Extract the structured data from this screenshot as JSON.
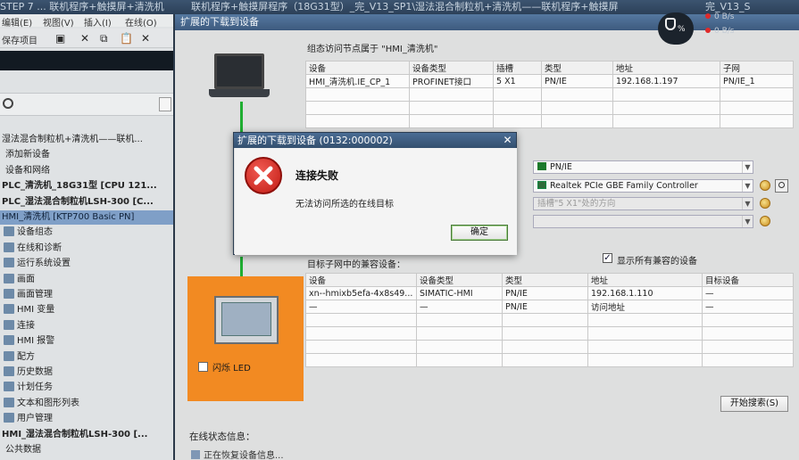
{
  "window": {
    "title_left": "STEP 7 ... 联机程序+触摸屏+清洗机",
    "title_main": "联机程序+触摸屏程序（18G31型）_完_V13_SP1\\湿法混合制粒机+清洗机——联机程序+触摸屏",
    "title_right": "完_V13_S"
  },
  "left_pane": {
    "menu": [
      "编辑(E)",
      "视图(V)",
      "插入(I)",
      "在线(O)"
    ],
    "toolbar_label": "保存项目",
    "toolbar_icons": [
      "save-icon",
      "cut-icon",
      "copy-icon",
      "paste-icon",
      "delete-icon"
    ],
    "toolbar_glyphs": [
      "▣",
      "✕",
      "⧉",
      "📋",
      "✕"
    ],
    "tree": [
      {
        "label": "湿法混合制粒机+清洗机——联机...",
        "style": "plain"
      },
      {
        "label": "添加新设备",
        "style": "plain"
      },
      {
        "label": "设备和网络",
        "style": "plain"
      },
      {
        "label": "PLC_清洗机_18G31型 [CPU 121...",
        "style": "bold"
      },
      {
        "label": "PLC_湿法混合制粒机LSH-300 [C...",
        "style": "bold"
      },
      {
        "label": "HMI_清洗机 [KTP700 Basic PN]",
        "style": "selected"
      },
      {
        "label": "设备组态",
        "style": "plain"
      },
      {
        "label": "在线和诊断",
        "style": "plain"
      },
      {
        "label": "运行系统设置",
        "style": "plain"
      },
      {
        "label": "画面",
        "style": "plain"
      },
      {
        "label": "画面管理",
        "style": "plain"
      },
      {
        "label": "HMI 变量",
        "style": "plain"
      },
      {
        "label": "连接",
        "style": "plain"
      },
      {
        "label": "HMI 报警",
        "style": "plain"
      },
      {
        "label": "配方",
        "style": "plain"
      },
      {
        "label": "历史数据",
        "style": "plain"
      },
      {
        "label": "计划任务",
        "style": "plain"
      },
      {
        "label": "文本和图形列表",
        "style": "plain"
      },
      {
        "label": "用户管理",
        "style": "plain"
      },
      {
        "label": "HMI_湿法混合制粒机LSH-300 [...",
        "style": "bold"
      },
      {
        "label": "公共数据",
        "style": "plain"
      }
    ]
  },
  "main": {
    "panel_title": "扩展的下载到设备",
    "config_header": "组态访问节点属于 \"HMI_清洗机\"",
    "config_table": {
      "columns": [
        "设备",
        "设备类型",
        "插槽",
        "类型",
        "地址",
        "子网"
      ],
      "rows": [
        [
          "HMI_清洗机.IE_CP_1",
          "PROFINET接口",
          "5 X1",
          "PN/IE",
          "192.168.1.197",
          "PN/IE_1"
        ]
      ]
    },
    "pgpc": {
      "interface_type": "PN/IE",
      "interface": "Realtek PCIe GBE Family Controller",
      "connect_to": "插槽\"5 X1\"处的方向",
      "gateway": ""
    },
    "target_header": "目标子网中的兼容设备：",
    "show_all_label": "显示所有兼容的设备",
    "target_table": {
      "columns": [
        "设备",
        "设备类型",
        "类型",
        "地址",
        "目标设备"
      ],
      "rows": [
        [
          "xn--hmixb5efa-4x8s49...",
          "SIMATIC-HMI",
          "PN/IE",
          "192.168.1.110",
          "—"
        ],
        [
          "—",
          "—",
          "PN/IE",
          "访问地址",
          "—"
        ]
      ]
    },
    "flash_led_label": "闪烁 LED",
    "start_search_label": "开始搜索(S)",
    "status_title": "在线状态信息：",
    "status_line": "正在恢复设备信息..."
  },
  "dialog": {
    "title": "扩展的下载到设备 (0132:000002)",
    "close_glyph": "✕",
    "heading": "连接失败",
    "message": "无法访问所选的在线目标",
    "ok_label": "确定"
  },
  "hud": {
    "percent": "%",
    "r1": "0 B/s",
    "r2": "0 B/s"
  },
  "colors": {
    "accent_title": "#3d5a7e",
    "selection": "#7f9fc7",
    "error_red": "#c21c14",
    "network_green": "#1fae32",
    "hmi_orange": "#f28a22"
  }
}
